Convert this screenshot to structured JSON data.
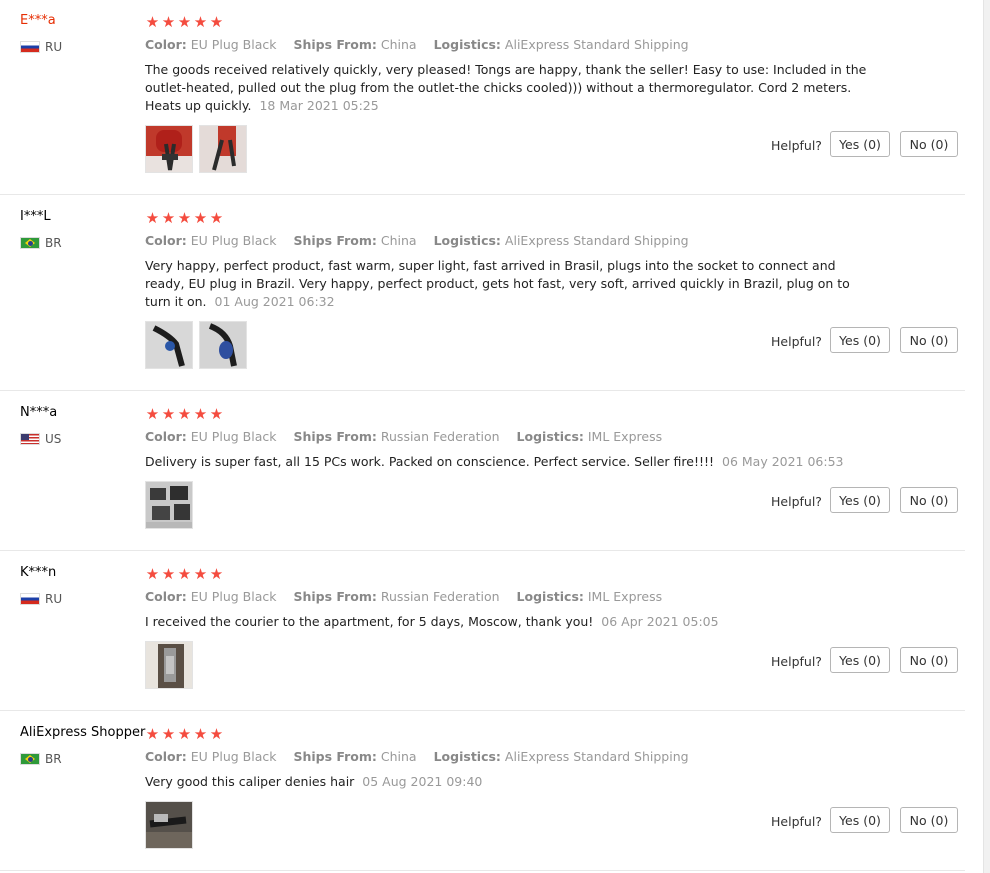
{
  "helpful_label": "Helpful?",
  "star_char": "★",
  "colors": {
    "star": "#f44c3f",
    "highlight_name": "#e62e04",
    "muted": "#999999",
    "button_border": "#b5b5b5"
  },
  "reviews": [
    {
      "user": "E***a",
      "country_code": "RU",
      "flag_icon": "russia-flag-icon",
      "rating": 5,
      "color_label": "Color:",
      "color_value": "EU Plug Black",
      "ships_label": "Ships From:",
      "ships_value": "China",
      "logistics_label": "Logistics:",
      "logistics_value": "AliExpress Standard Shipping",
      "text": "The goods received relatively quickly, very pleased! Tongs are happy, thank the seller! Easy to use: Included in the outlet-heated, pulled out the plug from the outlet-the chicks cooled))) without a thermoregulator. Cord 2 meters. Heats up quickly.",
      "date": "18 Mar 2021 05:25",
      "photos": [
        "photo-red-tongs-icon",
        "photo-red-tongs-icon"
      ],
      "yes": "Yes (0)",
      "no": "No (0)"
    },
    {
      "user": "I***L",
      "country_code": "BR",
      "flag_icon": "brazil-flag-icon",
      "rating": 5,
      "color_label": "Color:",
      "color_value": "EU Plug Black",
      "ships_label": "Ships From:",
      "ships_value": "China",
      "logistics_label": "Logistics:",
      "logistics_value": "AliExpress Standard Shipping",
      "text": "Very happy, perfect product, fast warm, super light, fast arrived in Brasil, plugs into the socket to connect and ready, EU plug in Brazil. Very happy, perfect product, gets hot fast, very soft, arrived quickly in Brazil, plug on to turn it on.",
      "date": "01 Aug 2021 06:32",
      "photos": [
        "photo-black-tongs-icon",
        "photo-blue-tongs-icon"
      ],
      "yes": "Yes (0)",
      "no": "No (0)"
    },
    {
      "user": "N***a",
      "country_code": "US",
      "flag_icon": "usa-flag-icon",
      "rating": 5,
      "color_label": "Color:",
      "color_value": "EU Plug Black",
      "ships_label": "Ships From:",
      "ships_value": "Russian Federation",
      "logistics_label": "Logistics:",
      "logistics_value": "IML Express",
      "text": "Delivery is super fast, all 15 PCs work. Packed on conscience. Perfect service. Seller fire!!!!",
      "date": "06 May 2021 06:53",
      "photos": [
        "photo-package-icon"
      ],
      "yes": "Yes (0)",
      "no": "No (0)"
    },
    {
      "user": "K***n",
      "country_code": "RU",
      "flag_icon": "russia-flag-icon",
      "rating": 5,
      "color_label": "Color:",
      "color_value": "EU Plug Black",
      "ships_label": "Ships From:",
      "ships_value": "Russian Federation",
      "logistics_label": "Logistics:",
      "logistics_value": "IML Express",
      "text": "I received the courier to the apartment, for 5 days, Moscow, thank you!",
      "date": "06 Apr 2021 05:05",
      "photos": [
        "photo-device-icon"
      ],
      "yes": "Yes (0)",
      "no": "No (0)"
    },
    {
      "user": "AliExpress Shopper",
      "country_code": "BR",
      "flag_icon": "brazil-flag-icon",
      "rating": 5,
      "color_label": "Color:",
      "color_value": "EU Plug Black",
      "ships_label": "Ships From:",
      "ships_value": "China",
      "logistics_label": "Logistics:",
      "logistics_value": "AliExpress Standard Shipping",
      "text": "Very good this caliper denies hair",
      "date": "05 Aug 2021 09:40",
      "photos": [
        "photo-tongs-table-icon"
      ],
      "yes": "Yes (0)",
      "no": "No (0)"
    }
  ]
}
